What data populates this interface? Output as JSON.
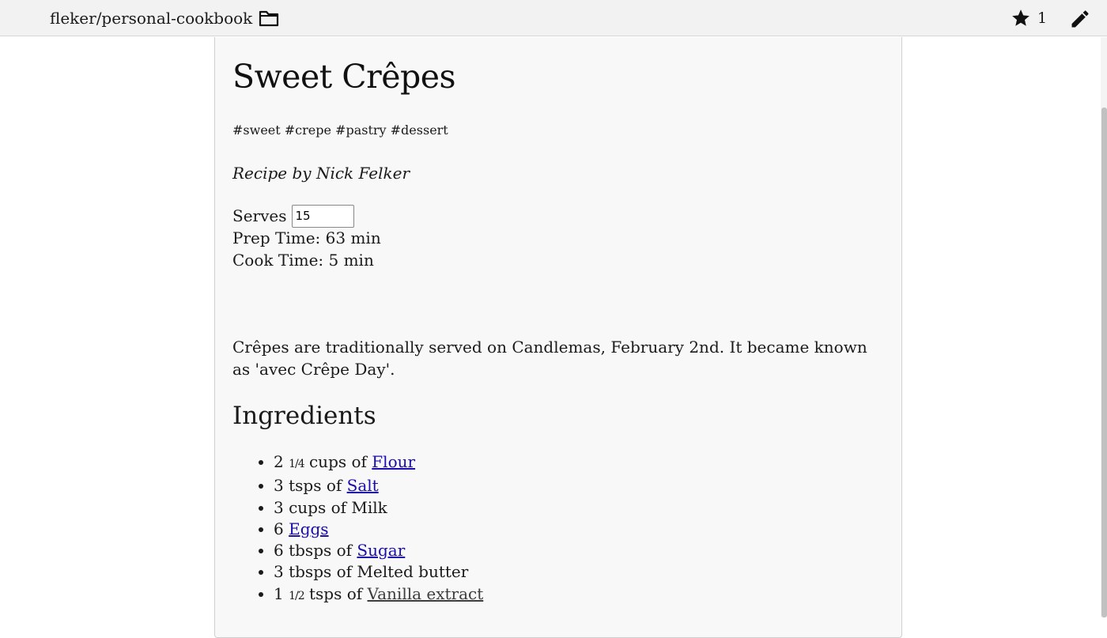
{
  "header": {
    "repo": "fleker/personal-cookbook",
    "star_count": "1"
  },
  "recipe": {
    "title": "Sweet Crêpes",
    "tags": "#sweet #crepe #pastry #dessert",
    "author": "Recipe by Nick Felker",
    "serves_label": "Serves",
    "serves_value": "15",
    "prep_time": "Prep Time: 63 min",
    "cook_time": "Cook Time: 5 min",
    "description": "Crêpes are traditionally served on Candlemas, February 2nd. It became known as 'avec Crêpe Day'.",
    "ingredients_heading": "Ingredients",
    "ingredients": [
      {
        "qty": "2 ",
        "frac": "1/4",
        "unit": " cups of ",
        "name": "Flour",
        "linked": true
      },
      {
        "qty": "3",
        "frac": "",
        "unit": " tsps of ",
        "name": "Salt",
        "linked": true
      },
      {
        "qty": "3",
        "frac": "",
        "unit": " cups of ",
        "name": "Milk",
        "linked": false
      },
      {
        "qty": "6",
        "frac": "",
        "unit": " ",
        "name": "Eggs",
        "linked": true
      },
      {
        "qty": "6",
        "frac": "",
        "unit": " tbsps of ",
        "name": "Sugar",
        "linked": true
      },
      {
        "qty": "3",
        "frac": "",
        "unit": " tbsps of ",
        "name": "Melted butter",
        "linked": false
      },
      {
        "qty": "1 ",
        "frac": "1/2",
        "unit": " tsps of ",
        "name": "Vanilla extract",
        "linked": true
      }
    ]
  },
  "icons": {
    "repo": "folder-icon",
    "star": "star-icon",
    "edit": "pencil-icon"
  },
  "colors": {
    "link": "#1a0dab",
    "visited_link": "#3d3d3d",
    "header_bg": "#f2f2f2",
    "card_bg": "#f8f8f8"
  }
}
